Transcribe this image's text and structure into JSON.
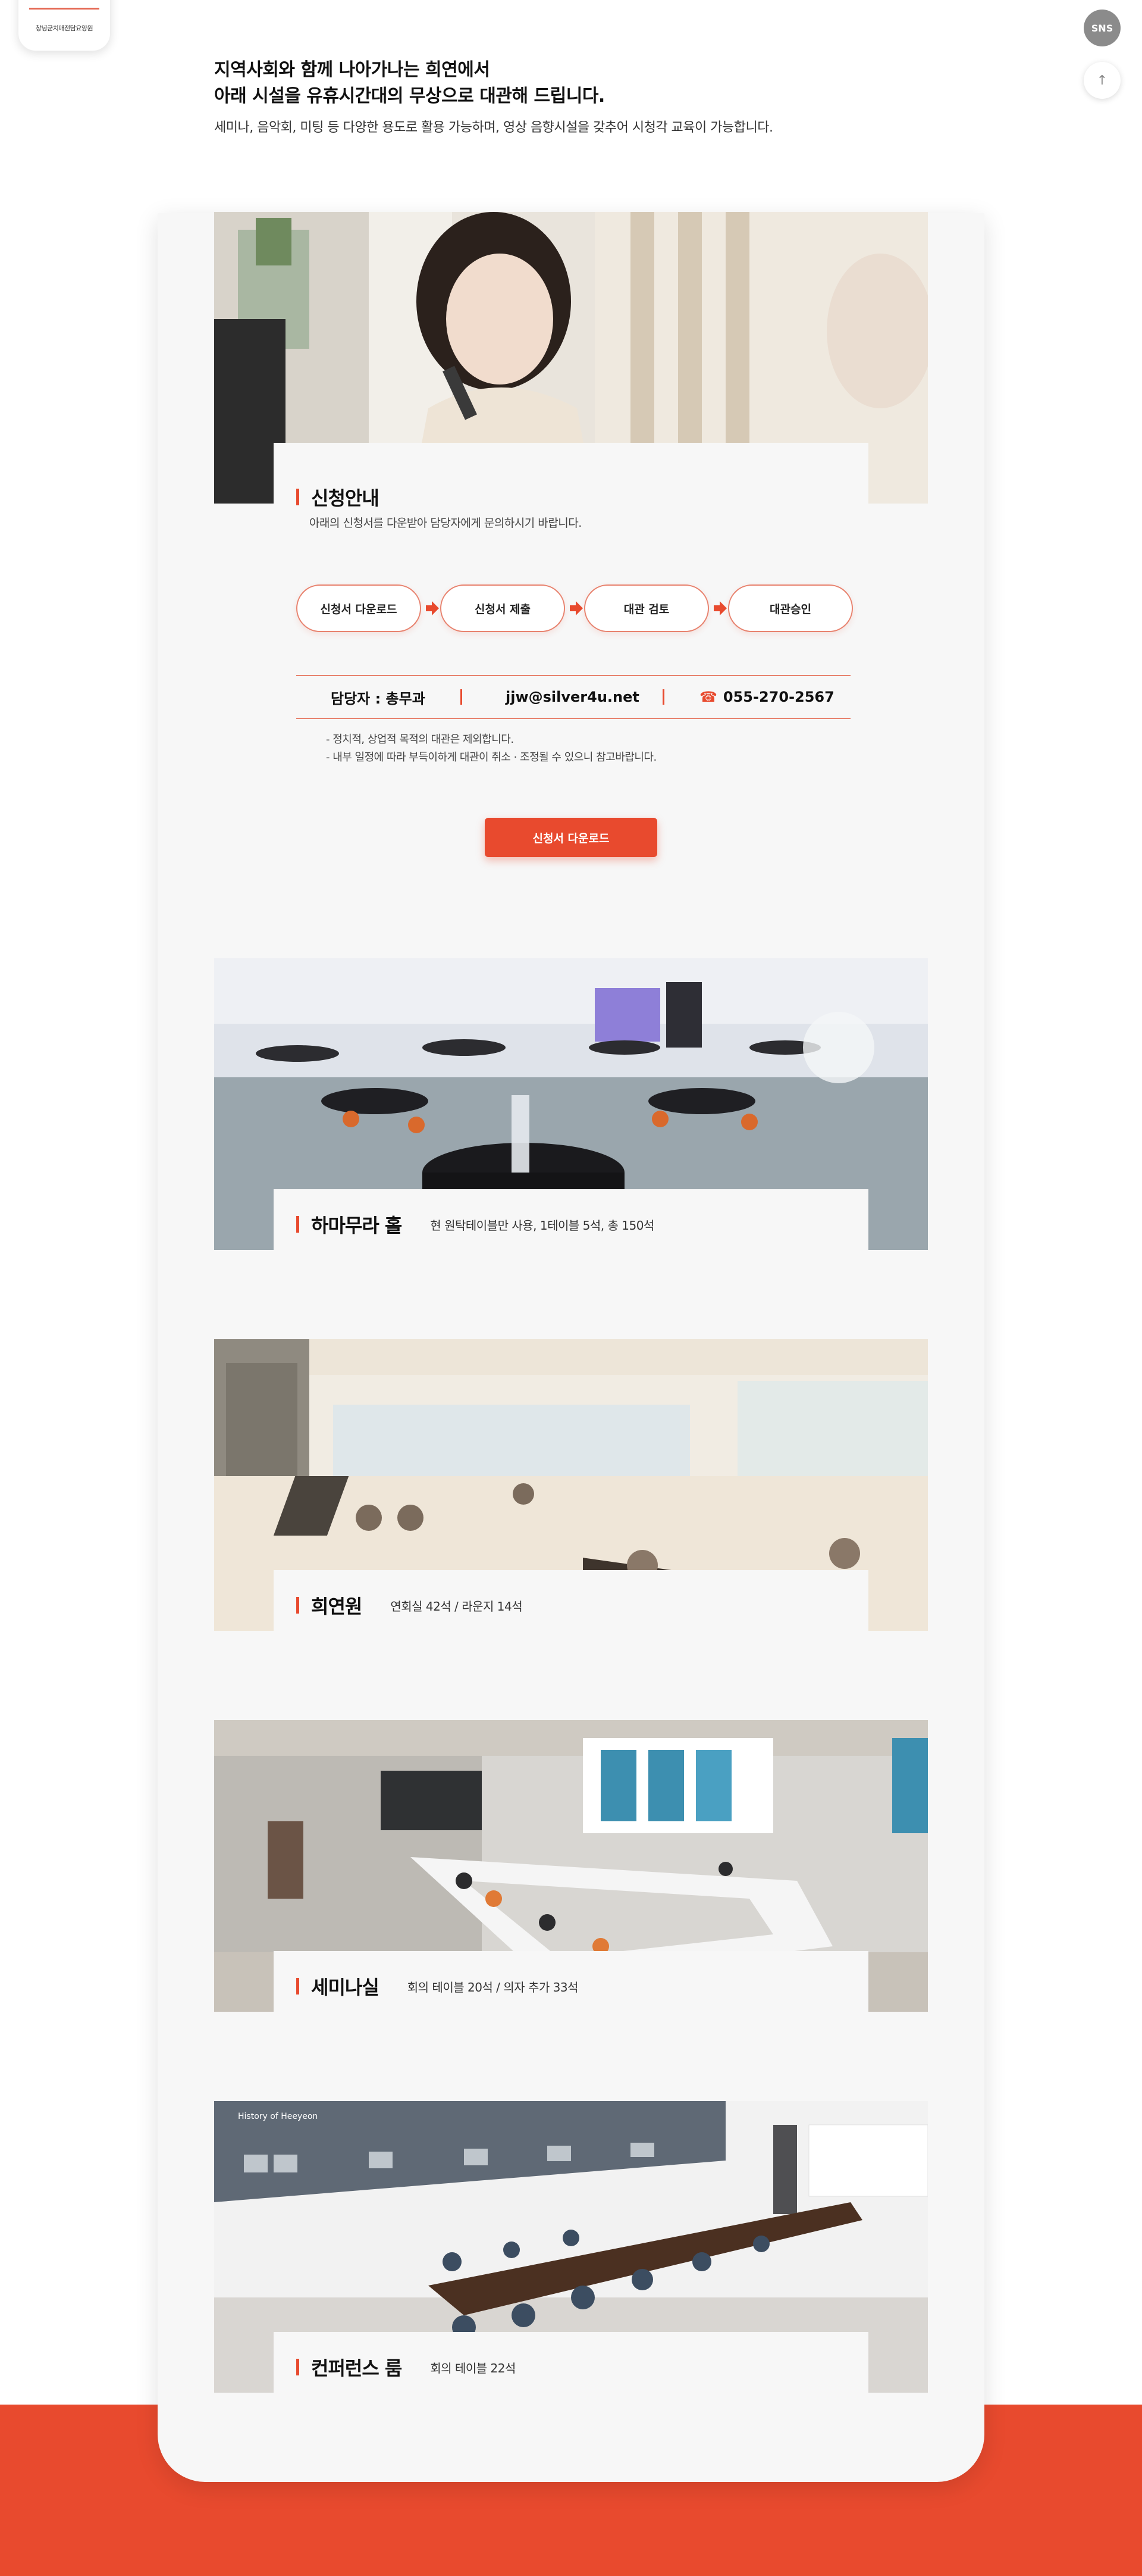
{
  "header": {
    "logo_text": "창녕군치매전담요양원",
    "sns_label": "SNS",
    "top_label": "↑"
  },
  "intro": {
    "line1": "지역사회와 함께 나아가나는 희연에서",
    "line2": "아래 시설을 유휴시간대의 무상으로 대관해 드립니다.",
    "desc": "세미나, 음악회, 미팅 등 다양한 용도로 활용 가능하며, 영상 음향시설을 갖추어 시청각 교육이 가능합니다."
  },
  "apply": {
    "title": "신청안내",
    "desc": "아래의 신청서를 다운받아 담당자에게 문의하시기 바랍니다.",
    "steps": [
      "신청서 다운로드",
      "신청서 제출",
      "대관 검토",
      "대관승인"
    ],
    "contact": {
      "manager": "담당자 : 총무과",
      "email": "jjw@silver4u.net",
      "phone": "055-270-2567"
    },
    "notes": [
      "- 정치적, 상업적 목적의 대관은 제외합니다.",
      "- 내부 일정에 따라 부득이하게 대관이 취소 · 조정될 수 있으니 참고바랍니다."
    ],
    "download_button": "신청서 다운로드"
  },
  "facilities": [
    {
      "name": "하마무라 홀",
      "desc": "현 원탁테이블만 사용, 1테이블 5석, 총 150석"
    },
    {
      "name": "희연원",
      "desc": "연회실 42석 / 라운지 14석"
    },
    {
      "name": "세미나실",
      "desc": "회의 테이블 20석 / 의자 추가 33석"
    },
    {
      "name": "컨퍼런스 룸",
      "desc": "회의 테이블 22석"
    }
  ],
  "photos": {
    "conference_banner_text": "History of Heeyeon"
  },
  "colors": {
    "accent": "#e84a2e",
    "accent_light": "#e8836f",
    "card_bg": "#f7f7f7"
  }
}
